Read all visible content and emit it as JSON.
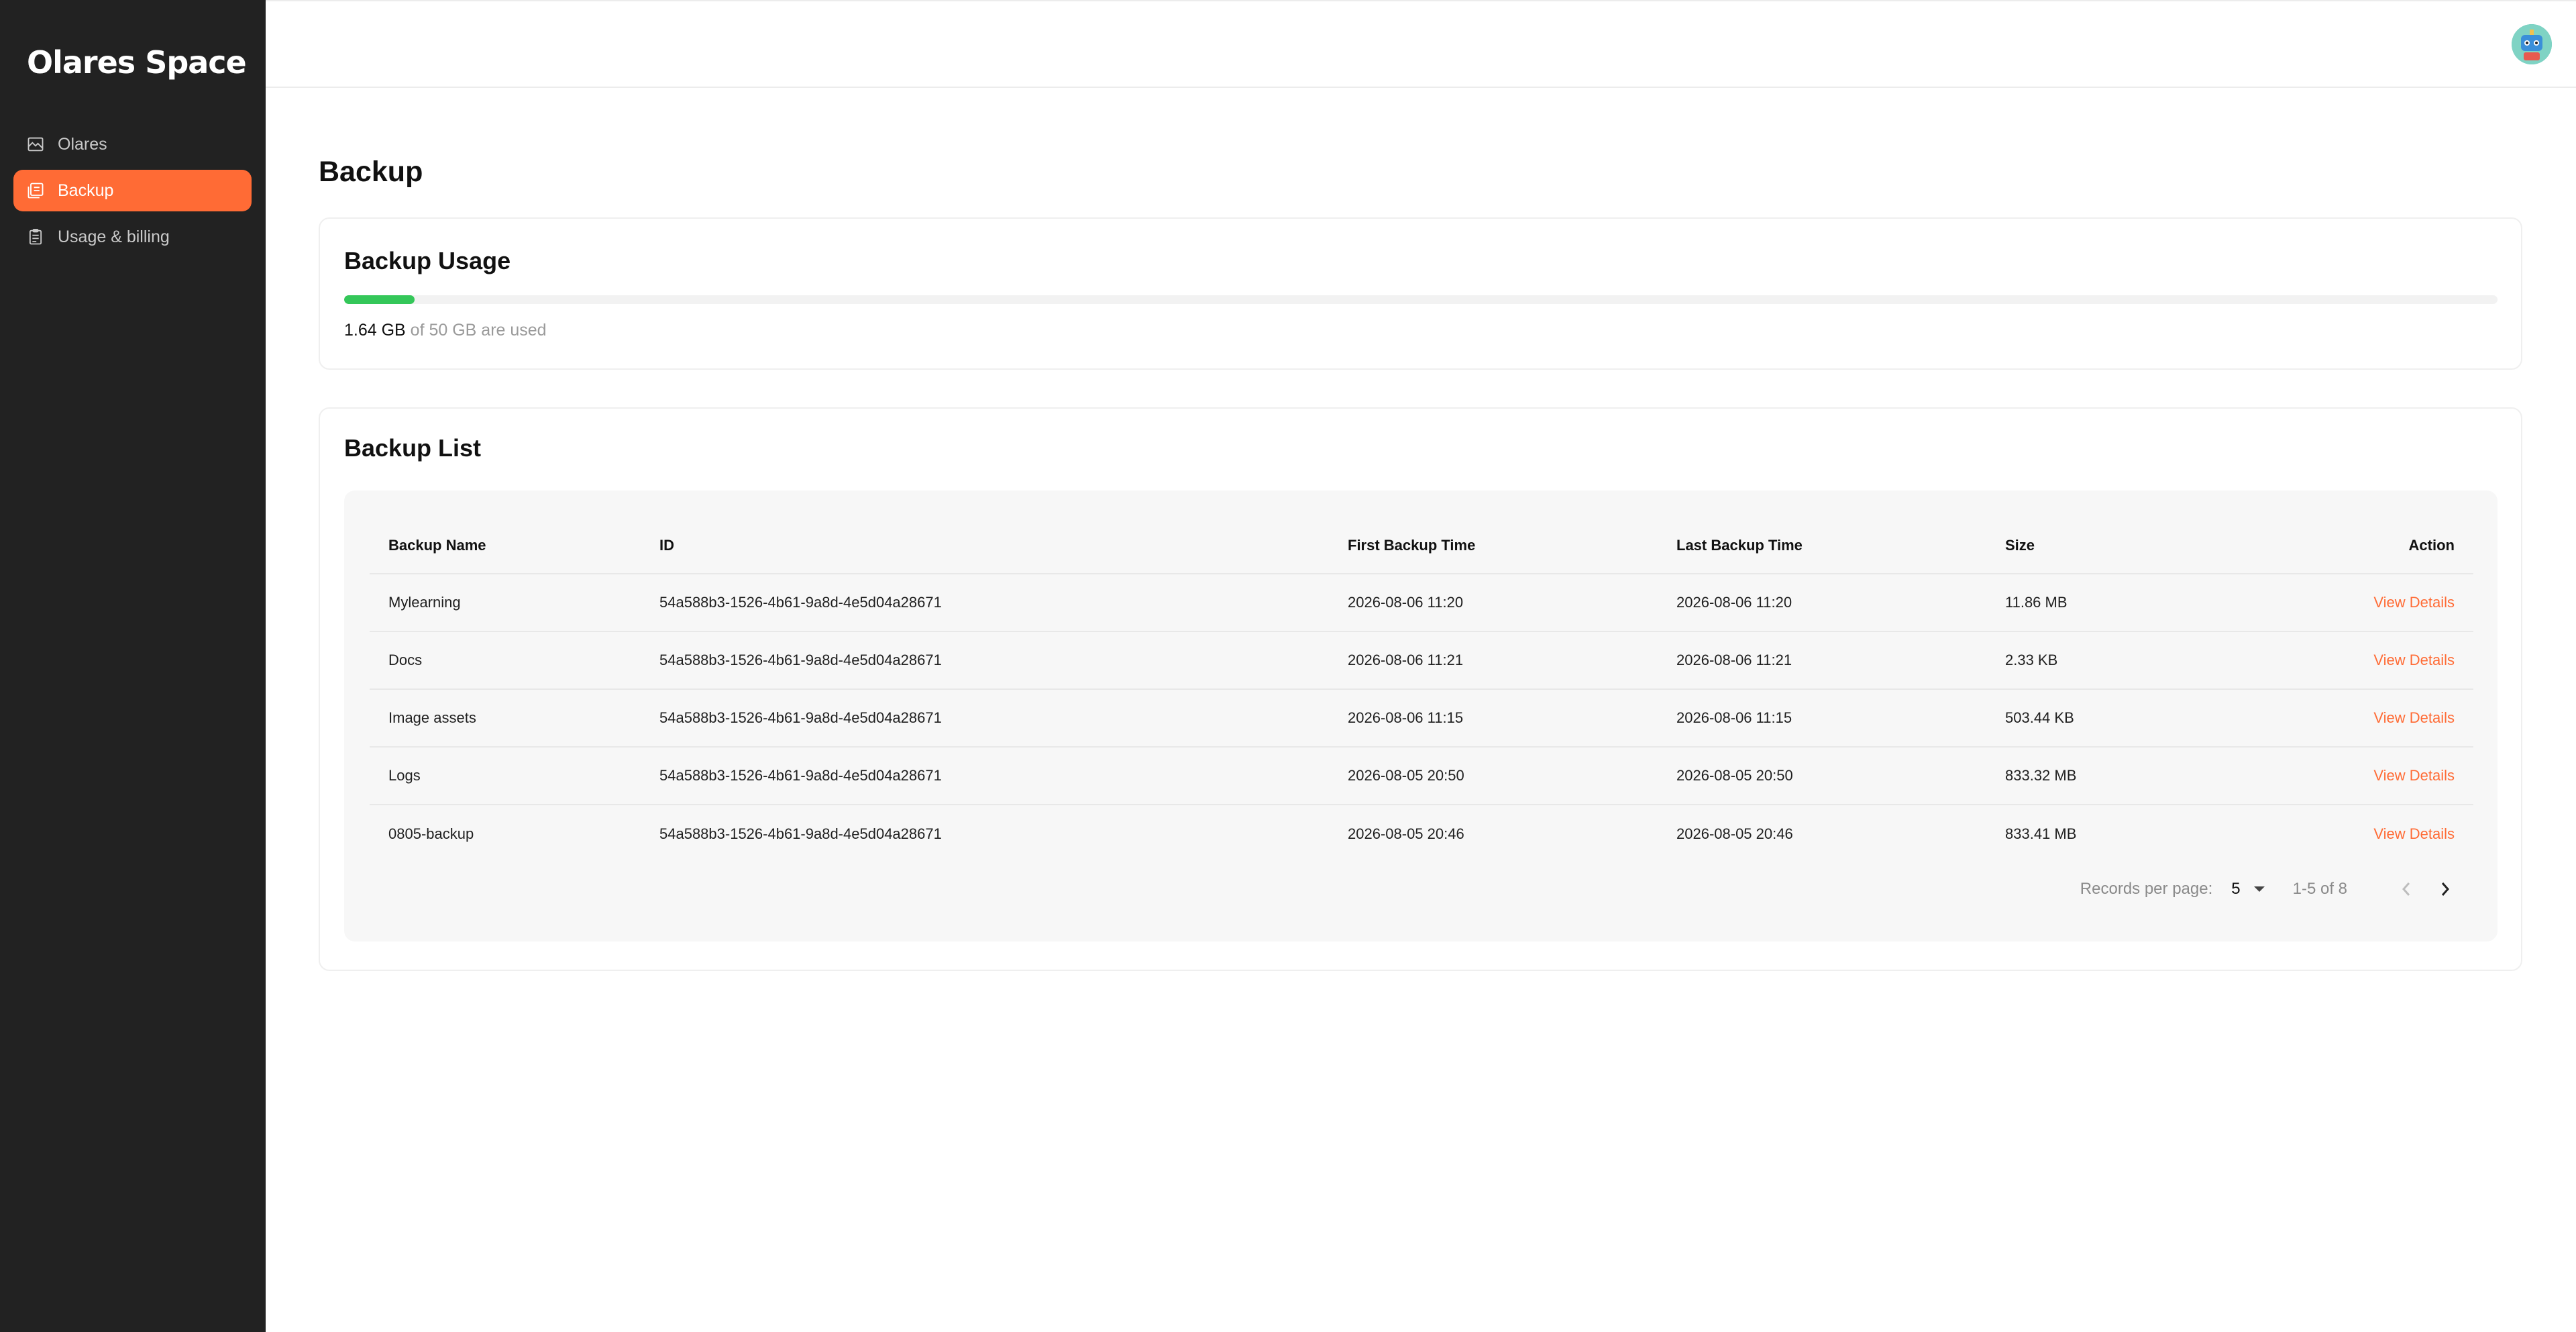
{
  "app": {
    "logo": "Olares Space"
  },
  "sidebar": {
    "items": [
      {
        "label": "Olares",
        "icon": "image-icon",
        "active": false
      },
      {
        "label": "Backup",
        "icon": "backup-icon",
        "active": true
      },
      {
        "label": "Usage & billing",
        "icon": "clipboard-icon",
        "active": false
      }
    ]
  },
  "page": {
    "title": "Backup"
  },
  "usage": {
    "title": "Backup Usage",
    "used": "1.64 GB",
    "rest": " of 50 GB are used",
    "fraction": 0.0328,
    "bar_color": "#34c759"
  },
  "list": {
    "title": "Backup List",
    "columns": [
      "Backup Name",
      "ID",
      "First Backup Time",
      "Last Backup Time",
      "Size",
      "Action"
    ],
    "rows": [
      {
        "name": "Mylearning",
        "id": "54a588b3-1526-4b61-9a8d-4e5d04a28671",
        "first": "2026-08-06 11:20",
        "last": "2026-08-06 11:20",
        "size": "11.86 MB",
        "action": "View Details"
      },
      {
        "name": "Docs",
        "id": "54a588b3-1526-4b61-9a8d-4e5d04a28671",
        "first": "2026-08-06 11:21",
        "last": "2026-08-06 11:21",
        "size": "2.33 KB",
        "action": "View Details"
      },
      {
        "name": "Image assets",
        "id": "54a588b3-1526-4b61-9a8d-4e5d04a28671",
        "first": "2026-08-06 11:15",
        "last": "2026-08-06 11:15",
        "size": "503.44 KB",
        "action": "View Details"
      },
      {
        "name": "Logs",
        "id": "54a588b3-1526-4b61-9a8d-4e5d04a28671",
        "first": "2026-08-05 20:50",
        "last": "2026-08-05 20:50",
        "size": "833.32 MB",
        "action": "View Details"
      },
      {
        "name": "0805-backup",
        "id": "54a588b3-1526-4b61-9a8d-4e5d04a28671",
        "first": "2026-08-05 20:46",
        "last": "2026-08-05 20:46",
        "size": "833.41 MB",
        "action": "View Details"
      }
    ],
    "pagination": {
      "rpp_label": "Records per page:",
      "rpp_value": "5",
      "range": "1-5 of 8"
    }
  },
  "colors": {
    "accent": "#ff6b35",
    "sidebar_bg": "#222222"
  }
}
